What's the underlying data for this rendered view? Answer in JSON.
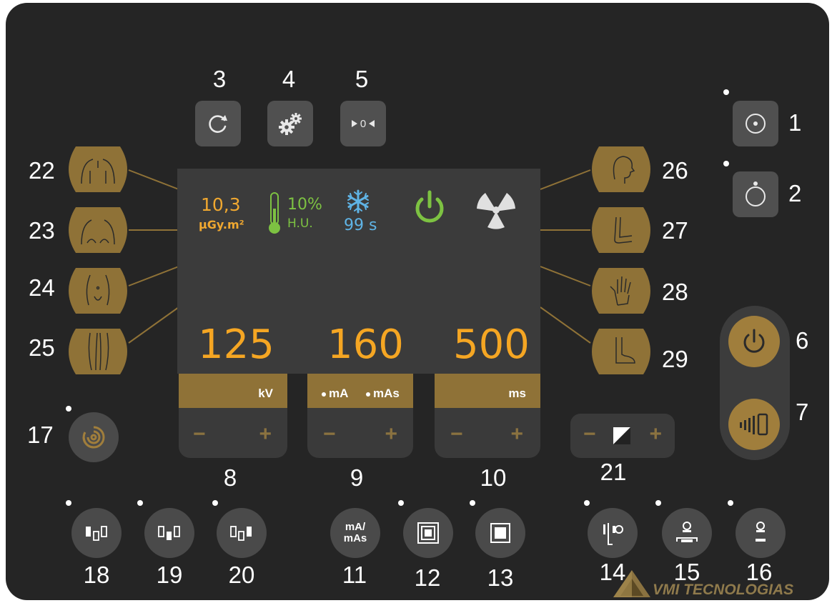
{
  "callouts": {
    "n1": "1",
    "n2": "2",
    "n3": "3",
    "n4": "4",
    "n5": "5",
    "n6": "6",
    "n7": "7",
    "n8": "8",
    "n9": "9",
    "n10": "10",
    "n11": "11",
    "n12": "12",
    "n13": "13",
    "n14": "14",
    "n15": "15",
    "n16": "16",
    "n17": "17",
    "n18": "18",
    "n19": "19",
    "n20": "20",
    "n21": "21",
    "n22": "22",
    "n23": "23",
    "n24": "24",
    "n25": "25",
    "n26": "26",
    "n27": "27",
    "n28": "28",
    "n29": "29"
  },
  "display": {
    "dose_value": "10,3",
    "dose_unit": "µGy.m²",
    "heat_value": "10%",
    "heat_unit": "H.U.",
    "cooling_time": "99 s",
    "kv_value": "125",
    "ma_value": "160",
    "ms_value": "500"
  },
  "controls": {
    "kv_label": "kV",
    "ma_label": "mA",
    "mas_label": "mAs",
    "ms_label": "ms",
    "minus": "−",
    "plus": "+"
  },
  "buttons": {
    "ma_mas_line1": "mA/",
    "ma_mas_line2": "mAs",
    "zero_label": "0"
  },
  "brand": {
    "name": "VMI TECNOLOGIAS"
  },
  "colors": {
    "panel": "#252525",
    "accent_gold": "#8f7237",
    "value_orange": "#f5a623",
    "power_green": "#7dc242",
    "cool_blue": "#5fb4e6",
    "dose_orange": "#f0a830"
  },
  "icons": {
    "btn1": "center-dot-icon",
    "btn2": "circle-dot-top-icon",
    "btn3": "refresh-icon",
    "btn4": "gears-icon",
    "btn5": "reset-zero-icon",
    "btn6": "power-icon",
    "btn7": "exposure-icon",
    "btn17": "spiral-icon",
    "btn21": "contrast-icon"
  }
}
